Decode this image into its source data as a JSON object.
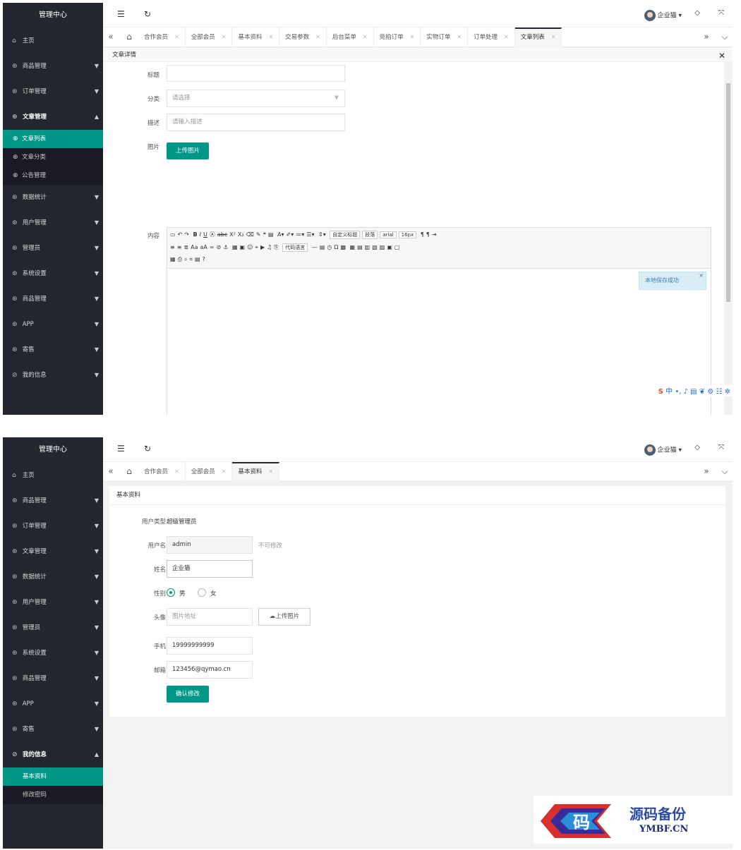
{
  "brand": "管理中心",
  "sidebar": {
    "home": "主页",
    "items": [
      "商品管理",
      "订单管理",
      "文章管理",
      "数据统计",
      "用户管理",
      "管理员",
      "系统设置",
      "商品管理",
      "APP",
      "寄售",
      "我的信息"
    ],
    "article_sub": [
      "文章列表",
      "文章分类",
      "公告管理"
    ],
    "myinfo_sub": [
      "基本资料",
      "修改密码"
    ]
  },
  "topbar": {
    "user": "企业猫"
  },
  "tabs1": [
    "合作会员",
    "全部会员",
    "基本资料",
    "交易参数",
    "后台菜单",
    "竞拍订单",
    "实物订单",
    "订单处理",
    "文章列表"
  ],
  "tabs2": [
    "合作会员",
    "全部会员",
    "基本资料"
  ],
  "editor": {
    "header": "文章详情",
    "labels": {
      "title": "标题",
      "category": "分类",
      "desc": "描述",
      "image": "图片",
      "content": "内容"
    },
    "category_ph": "请选择",
    "desc_ph": "请输入描述",
    "upload": "上传图片",
    "selects": [
      "自定义标题",
      "段落",
      "arial",
      "16px",
      "代码语言"
    ],
    "toast": "本地保存成功"
  },
  "profile": {
    "title": "基本资料",
    "labels": {
      "type": "用户类型",
      "username": "用户名",
      "name": "姓名",
      "gender": "性别",
      "avatar": "头像",
      "phone": "手机",
      "email": "邮箱"
    },
    "type_value": "超级管理员",
    "username": "admin",
    "username_note": "不可修改",
    "name": "企业猫",
    "male": "男",
    "female": "女",
    "avatar_ph": "图片地址",
    "upload": "上传图片",
    "phone": "19999999999",
    "email": "123456@qymao.cn",
    "submit": "确认修改"
  },
  "watermark": {
    "logo_char": "码",
    "cn": "源码备份",
    "en": "YMBF.CN"
  }
}
